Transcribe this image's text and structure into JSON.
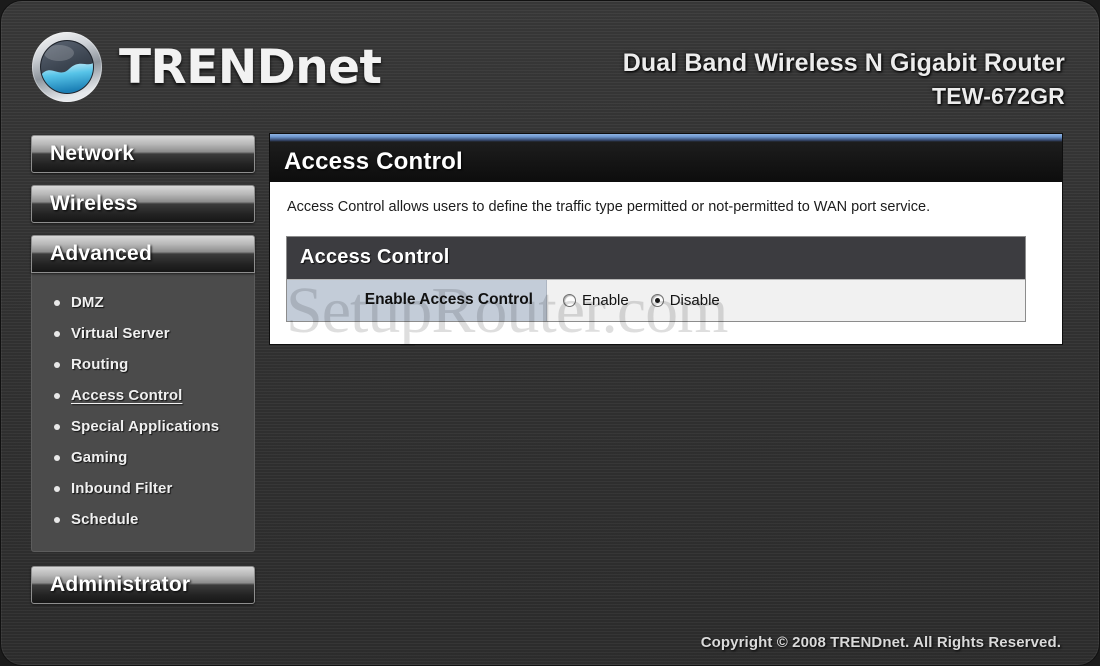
{
  "header": {
    "brand_upper": "TREND",
    "brand_lower": "net",
    "logo_icon": "trendnet-globe-icon",
    "product_name": "Dual Band Wireless N Gigabit Router",
    "model_number": "TEW-672GR"
  },
  "sidebar": {
    "buttons": [
      {
        "label": "Network"
      },
      {
        "label": "Wireless"
      },
      {
        "label": "Advanced"
      },
      {
        "label": "Administrator"
      }
    ],
    "submenu": [
      {
        "label": "DMZ",
        "active": false
      },
      {
        "label": "Virtual Server",
        "active": false
      },
      {
        "label": "Routing",
        "active": false
      },
      {
        "label": "Access Control",
        "active": true
      },
      {
        "label": "Special Applications",
        "active": false
      },
      {
        "label": "Gaming",
        "active": false
      },
      {
        "label": "Inbound Filter",
        "active": false
      },
      {
        "label": "Schedule",
        "active": false
      }
    ]
  },
  "main": {
    "page_title": "Access Control",
    "description": "Access Control allows users to define the traffic type permitted or not-permitted to WAN port service.",
    "watermark": "SetupRouter.com",
    "section": {
      "title": "Access Control",
      "rows": [
        {
          "label": "Enable Access Control",
          "options": [
            {
              "label": "Enable",
              "checked": false
            },
            {
              "label": "Disable",
              "checked": true
            }
          ]
        }
      ]
    }
  },
  "footer": {
    "copyright": "Copyright © 2008 TRENDnet. All Rights Reserved."
  },
  "colors": {
    "frame_bg": "#343434",
    "panel_bg": "#ffffff",
    "accent_blue": "#6e97cf",
    "label_cell": "#c3ccd8",
    "section_header": "#3c3c40"
  }
}
